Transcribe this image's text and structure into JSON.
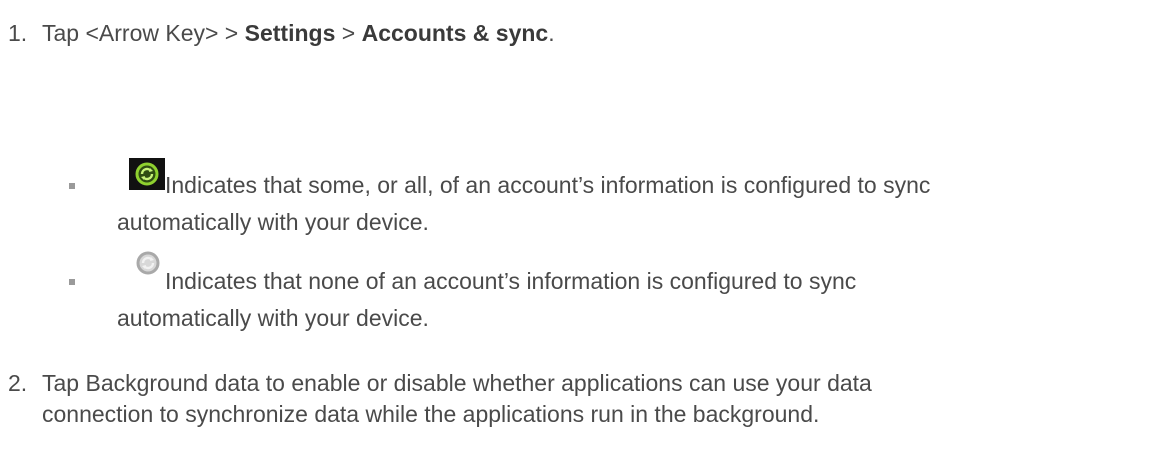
{
  "steps": [
    {
      "number": "1.",
      "parts": {
        "pre": "Tap <Arrow Key> > ",
        "b1": "Settings",
        "mid": " > ",
        "b2": "Accounts & sync",
        "post": "."
      }
    },
    {
      "number": "2.",
      "line1": "Tap Background data to enable or disable whether applications can use your data",
      "line2": "connection to synchronize data while the applications run in the background."
    }
  ],
  "bullets": [
    {
      "icon": "sync-on-icon",
      "line1": " Indicates that some, or all, of an account’s information is configured to sync",
      "line2": "automatically with your device."
    },
    {
      "icon": "sync-off-icon",
      "line1": " Indicates that none of an account’s information is configured to sync",
      "line2": "automatically with your device."
    }
  ],
  "colors": {
    "text": "#4a4a4a",
    "sync_on_bg": "#111111",
    "sync_on_ring": "#8fd12f",
    "sync_off": "#b8b8b8"
  }
}
